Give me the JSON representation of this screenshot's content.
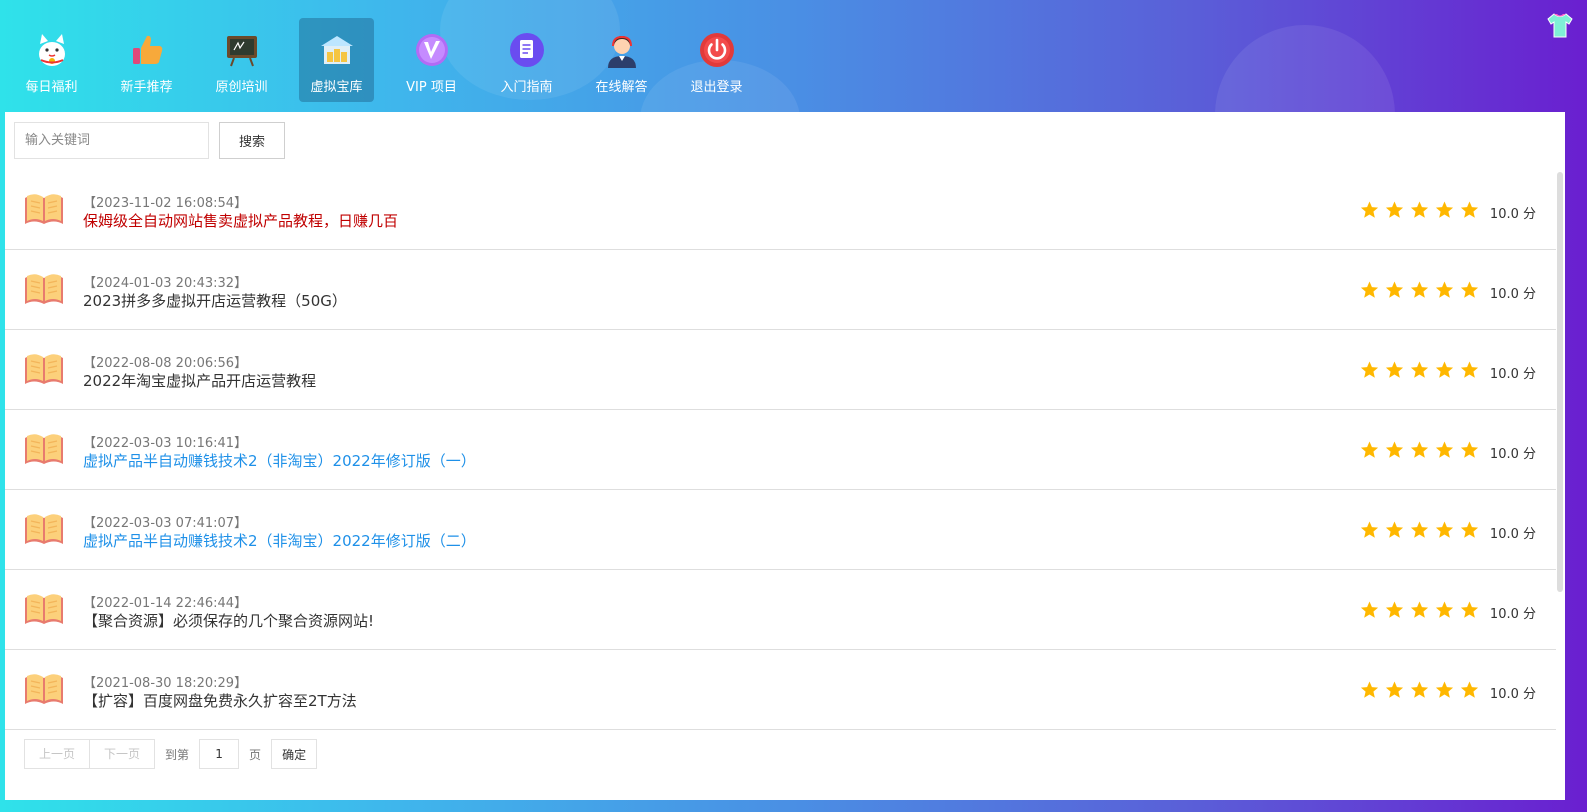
{
  "nav": {
    "items": [
      {
        "label": "每日福利",
        "icon": "lucky-cat-icon"
      },
      {
        "label": "新手推荐",
        "icon": "thumbs-up-icon"
      },
      {
        "label": "原创培训",
        "icon": "chalkboard-icon"
      },
      {
        "label": "虚拟宝库",
        "icon": "treasure-house-icon",
        "active": true
      },
      {
        "label": "VIP 项目",
        "icon": "vip-icon"
      },
      {
        "label": "入门指南",
        "icon": "guide-document-icon"
      },
      {
        "label": "在线解答",
        "icon": "support-agent-icon"
      },
      {
        "label": "退出登录",
        "icon": "power-icon"
      }
    ]
  },
  "search": {
    "placeholder": "输入关键词",
    "button_label": "搜索"
  },
  "list": {
    "items": [
      {
        "date": "【2023-11-02 16:08:54】",
        "title": "保姆级全自动网站售卖虚拟产品教程，日赚几百",
        "title_color": "#c00000",
        "rating": 5,
        "score": "10.0 分"
      },
      {
        "date": "【2024-01-03 20:43:32】",
        "title": "2023拼多多虚拟开店运营教程（50G）",
        "title_color": "#333333",
        "rating": 5,
        "score": "10.0 分"
      },
      {
        "date": "【2022-08-08 20:06:56】",
        "title": "2022年淘宝虚拟产品开店运营教程",
        "title_color": "#333333",
        "rating": 5,
        "score": "10.0 分"
      },
      {
        "date": "【2022-03-03 10:16:41】",
        "title": "虚拟产品半自动赚钱技术2（非淘宝）2022年修订版（一）",
        "title_color": "#1e90e8",
        "rating": 5,
        "score": "10.0 分"
      },
      {
        "date": "【2022-03-03 07:41:07】",
        "title": "虚拟产品半自动赚钱技术2（非淘宝）2022年修订版（二）",
        "title_color": "#1e90e8",
        "rating": 5,
        "score": "10.0 分"
      },
      {
        "date": "【2022-01-14 22:46:44】",
        "title": "【聚合资源】必须保存的几个聚合资源网站!",
        "title_color": "#333333",
        "rating": 5,
        "score": "10.0 分"
      },
      {
        "date": "【2021-08-30 18:20:29】",
        "title": "【扩容】百度网盘免费永久扩容至2T方法",
        "title_color": "#333333",
        "rating": 5,
        "score": "10.0 分"
      }
    ]
  },
  "pager": {
    "prev": "上一页",
    "next": "下一页",
    "goto": "到第",
    "page_value": "1",
    "page_unit": "页",
    "confirm": "确定"
  },
  "colors": {
    "star": "#ffb800"
  }
}
